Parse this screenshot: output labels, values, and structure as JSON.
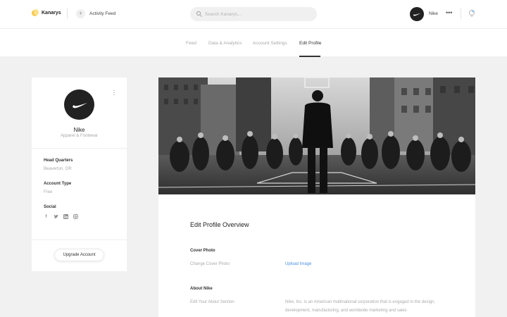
{
  "header": {
    "brand": "Kanarys",
    "activity_label": "Activity Feed",
    "add_icon": "plus-icon",
    "search_placeholder": "Search Kanarys...",
    "user_name": "Nike",
    "more_icon": "more-horizontal-icon",
    "notification_icon": "notification-icon"
  },
  "tabs": [
    {
      "label": "Feed",
      "active": false
    },
    {
      "label": "Data & Analytics",
      "active": false
    },
    {
      "label": "Account Settings",
      "active": false
    },
    {
      "label": "Edit Profile",
      "active": true
    }
  ],
  "profile": {
    "name": "Nike",
    "category": "Apparel & Footwear",
    "headquarters_label": "Head Quarters",
    "headquarters_value": "Beaverton, OR",
    "account_type_label": "Account Type",
    "account_type_value": "Free",
    "social_label": "Social",
    "socials": [
      "facebook-icon",
      "twitter-icon",
      "linkedin-icon",
      "instagram-icon"
    ],
    "upgrade_label": "Upgrade Account"
  },
  "edit": {
    "title": "Edit Profile Overview",
    "cover_label": "Cover Photo",
    "cover_hint": "Change Cover Photo",
    "upload_label": "Upload Image",
    "about_label": "About Nike",
    "about_hint": "Edit Your About Section",
    "about_text": "Nike, Inc. is an American multinational corporation that is engaged in the design, development, manufacturing, and worldwide marketing and sales"
  },
  "colors": {
    "accent": "#4a90e2",
    "brand": "#f5c948",
    "background": "#f1f1f1"
  }
}
